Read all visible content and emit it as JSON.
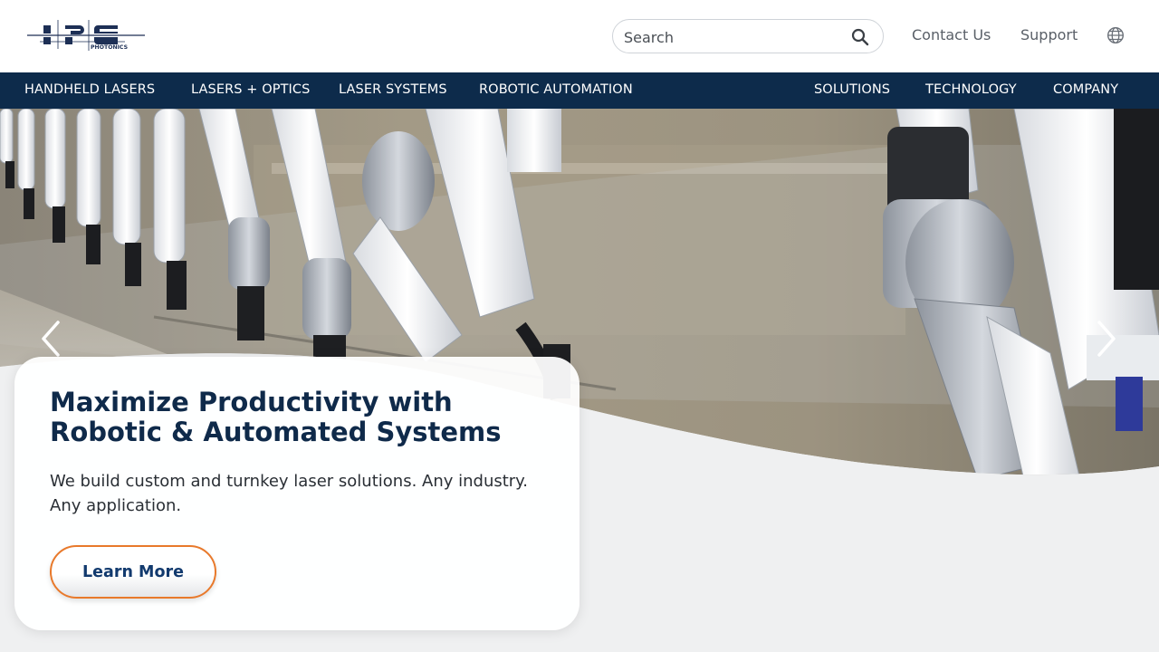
{
  "header": {
    "logo_text": "IPG",
    "logo_subtext": "PHOTONICS",
    "search": {
      "placeholder": "Search",
      "icon": "search-icon"
    },
    "links": [
      {
        "label": "Contact Us"
      },
      {
        "label": "Support"
      }
    ],
    "language_icon": "globe-icon"
  },
  "nav": {
    "left": [
      {
        "label": "HANDHELD LASERS"
      },
      {
        "label": "LASERS + OPTICS"
      },
      {
        "label": "LASER SYSTEMS"
      },
      {
        "label": "ROBOTIC AUTOMATION"
      }
    ],
    "right": [
      {
        "label": "SOLUTIONS"
      },
      {
        "label": "TECHNOLOGY"
      },
      {
        "label": "COMPANY"
      }
    ]
  },
  "hero": {
    "title_line1": "Maximize Productivity with",
    "title_line2": "Robotic & Automated Systems",
    "text_line1": "We build custom and turnkey laser solutions. Any industry.",
    "text_line2": "Any application.",
    "cta_label": "Learn More",
    "prev_icon": "chevron-left-icon",
    "next_icon": "chevron-right-icon"
  },
  "colors": {
    "nav_background": "#0d2b4b",
    "title_color": "#0f2a4a",
    "cta_border": "#e8792b",
    "cta_text": "#123a6e"
  }
}
